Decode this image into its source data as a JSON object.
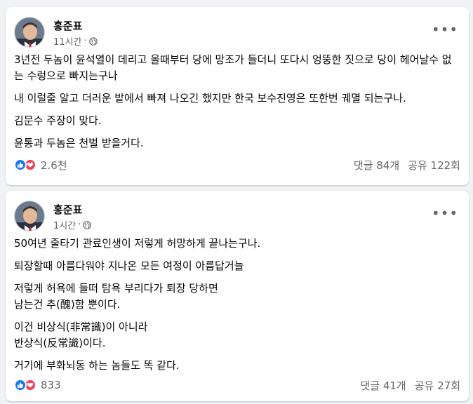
{
  "colors": {
    "background": "#f0f2f5",
    "card": "#ffffff",
    "text": "#050505",
    "secondary_text": "#65676b",
    "like_blue": "#1877f2",
    "love_red": "#f33e58"
  },
  "posts": [
    {
      "author": "홍준표",
      "time": "11시간",
      "separator": "·",
      "privacy_icon": "globe-icon",
      "paragraphs": [
        "3년전 두놈이 윤석열이 데리고 올때부터 당에 망조가 들더니 또다시 엉뚱한 짓으로 당이 헤어날수 없는 수렁으로 빠지는구나",
        "내 이럴줄 알고  더러운 밭에서  빠져 나오긴 했지만 한국 보수진영은 또한번 궤멸 되는구나.",
        "김문수 주장이 맞다.",
        "윤통과 두놈은 천벌 받을거다."
      ],
      "reaction_count": "2.6천",
      "comments": "댓글 84개",
      "shares": "공유 122회"
    },
    {
      "author": "홍준표",
      "time": "1시간",
      "separator": "·",
      "privacy_icon": "globe-icon",
      "paragraphs": [
        "50여년 줄타기 관료인생이 저렇게 허망하게 끝나는구나.",
        "퇴장할때 아름다워야 지나온 모든 여정이 아름답거늘",
        "저렇게 허욕에 들떠 탐욕 부리다가 퇴장 당하면\n남는건 추(醜)함 뿐이다.",
        "이건 비상식(非常識)이 아니라\n반상식(反常識)이다.",
        "거기에 부화뇌동 하는 놈들도 똑 같다."
      ],
      "reaction_count": "833",
      "comments": "댓글 41개",
      "shares": "공유 27회"
    }
  ]
}
